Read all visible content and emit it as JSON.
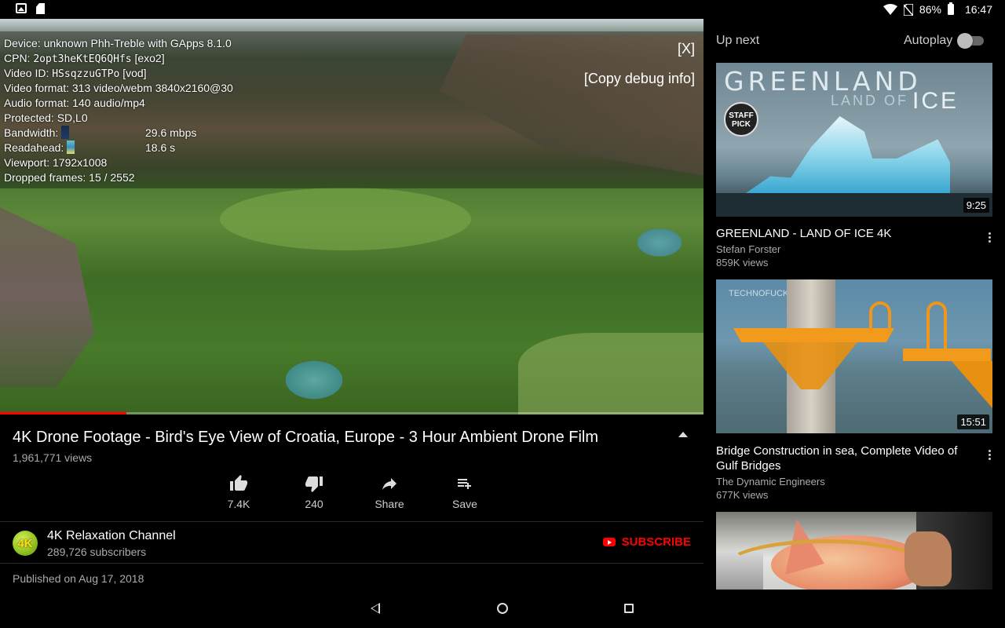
{
  "status_bar": {
    "battery": "86%",
    "time": "16:47",
    "icons": [
      "image-icon",
      "sd-card-icon",
      "wifi-icon",
      "no-sim-icon",
      "battery-icon"
    ]
  },
  "player": {
    "debug": {
      "device": "Device: unknown Phh-Treble with GApps 8.1.0",
      "cpn_label": "CPN: ",
      "cpn_value": "2opt3heKtEQ6QHfs",
      "cpn_suffix": " [exo2]",
      "video_id_label": "Video ID: ",
      "video_id_value": "HSsqzzuGTPo",
      "video_id_suffix": " [vod]",
      "video_format": "Video format: 313 video/webm 3840x2160@30",
      "audio_format": "Audio format: 140 audio/mp4",
      "protected": "Protected: SD,L0",
      "bandwidth_label": "Bandwidth:",
      "bandwidth_value": "29.6 mbps",
      "readahead_label": "Readahead:",
      "readahead_value": "18.6 s",
      "viewport": "Viewport: 1792x1008",
      "dropped_frames": "Dropped frames: 15 / 2552"
    },
    "close_label": "[X]",
    "copy_label": "[Copy debug info]",
    "progress_fraction": 0.18
  },
  "video": {
    "title": "4K Drone Footage - Bird's Eye View of Croatia, Europe - 3 Hour Ambient Drone Film",
    "views": "1,961,771 views",
    "actions": {
      "like": "7.4K",
      "dislike": "240",
      "share": "Share",
      "save": "Save"
    },
    "channel": {
      "avatar_text": "4K",
      "name": "4K Relaxation Channel",
      "subscribers": "289,726 subscribers",
      "subscribe_label": "SUBSCRIBE"
    },
    "published": "Published on Aug 17, 2018"
  },
  "up_next": {
    "title": "Up next",
    "autoplay_label": "Autoplay",
    "autoplay_on": false,
    "items": [
      {
        "thumb_text_1": "GREENLAND",
        "thumb_text_2": "LAND OF",
        "thumb_text_3": "ICE",
        "badge": "STAFF PICK",
        "duration": "9:25",
        "title": "GREENLAND - LAND OF ICE 4K",
        "channel": "Stefan Forster",
        "views": "859K views"
      },
      {
        "thumb_logo": "TECHNOFUCKS",
        "duration": "15:51",
        "title": "Bridge Construction in sea, Complete Video of Gulf Bridges",
        "channel": "The Dynamic Engineers",
        "views": "677K views"
      },
      {
        "duration": "",
        "title": "",
        "channel": "",
        "views": ""
      }
    ]
  },
  "colors": {
    "accent": "#ff0000",
    "background": "#000000",
    "secondary_text": "#aaaaaa"
  }
}
